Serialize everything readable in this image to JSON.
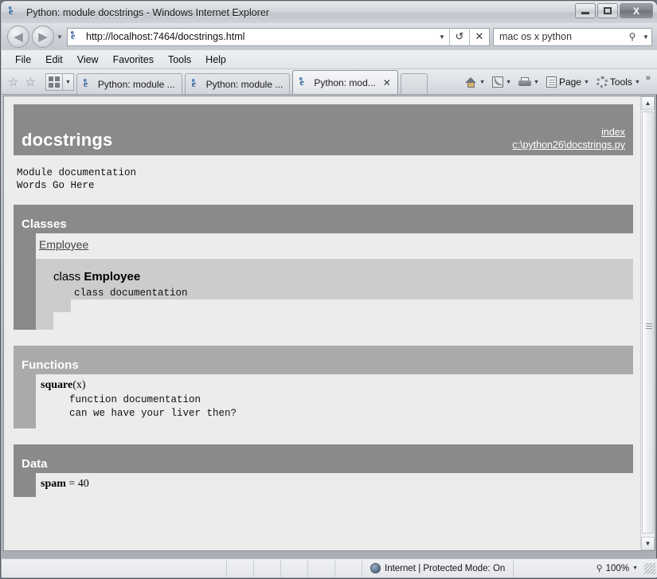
{
  "window": {
    "title": "Python: module docstrings - Windows Internet Explorer",
    "minimize_label": "Minimize",
    "maximize_label": "Maximize",
    "close_label": "X"
  },
  "navbar": {
    "back_glyph": "◀",
    "forward_glyph": "▶",
    "history_caret": "▼",
    "address_value": "http://localhost:7464/docstrings.html",
    "address_dropdown_glyph": "▼",
    "refresh_glyph": "↺",
    "stop_glyph": "✕",
    "search_value": "mac os x python",
    "search_placeholder": "Search",
    "search_glyph": "⚲",
    "search_dropdown_glyph": "▼"
  },
  "menubar": {
    "items": [
      {
        "label": "File",
        "accel": "F",
        "rest": "ile"
      },
      {
        "label": "Edit",
        "accel": "E",
        "rest": "dit"
      },
      {
        "label": "View",
        "accel": "V",
        "rest": "iew"
      },
      {
        "label": "Favorites",
        "accel": "F",
        "rest": "avorites",
        "pre": "F",
        "mid": "a"
      },
      {
        "label": "Tools",
        "accel": "T",
        "rest": "ools"
      },
      {
        "label": "Help",
        "accel": "H",
        "rest": "elp"
      }
    ]
  },
  "tabbar": {
    "favorites_star_glyph": "☆",
    "add_favorites_glyph": "☆",
    "quick_tabs_caret": "▼",
    "tabs": [
      {
        "label": "Python: module ...",
        "active": false
      },
      {
        "label": "Python: module ...",
        "active": false
      },
      {
        "label": "Python: mod...",
        "active": true,
        "close_glyph": "✕"
      }
    ],
    "commands": [
      {
        "name": "home",
        "label": "",
        "caret": "▼"
      },
      {
        "name": "feeds",
        "label": "",
        "caret": "▼"
      },
      {
        "name": "print",
        "label": "",
        "caret": "▼"
      },
      {
        "name": "page",
        "label": "Page",
        "caret": "▼"
      },
      {
        "name": "tools",
        "label": "Tools",
        "caret": "▼"
      }
    ],
    "overflow_glyph": "»"
  },
  "page": {
    "module": {
      "name": "docstrings",
      "links": [
        {
          "label": "index"
        },
        {
          "label": "c:\\python26\\docstrings.py"
        }
      ],
      "doc": "Module documentation\nWords Go Here"
    },
    "sections": [
      {
        "id": "classes",
        "heading": "Classes",
        "link": "Employee",
        "class_prefix": "class ",
        "class_name": "Employee",
        "class_doc": "class documentation"
      },
      {
        "id": "functions",
        "heading": "Functions",
        "func_name": "square",
        "func_args": "(x)",
        "func_doc": "function documentation\ncan we have your liver then?"
      },
      {
        "id": "data",
        "heading": "Data",
        "data_name": "spam",
        "data_value": " = 40"
      }
    ]
  },
  "scrollbar": {
    "up_glyph": "▲",
    "down_glyph": "▼"
  },
  "statusbar": {
    "zone_text": "Internet | Protected Mode: On",
    "zoom_level": "100%",
    "zoom_glyph": "⚲",
    "zoom_caret": "▼"
  },
  "colors": {
    "header_dark": "#8a8a8a",
    "header_light": "#aaaaaa",
    "page_bg": "#ececec",
    "class_box": "#cccccc"
  }
}
